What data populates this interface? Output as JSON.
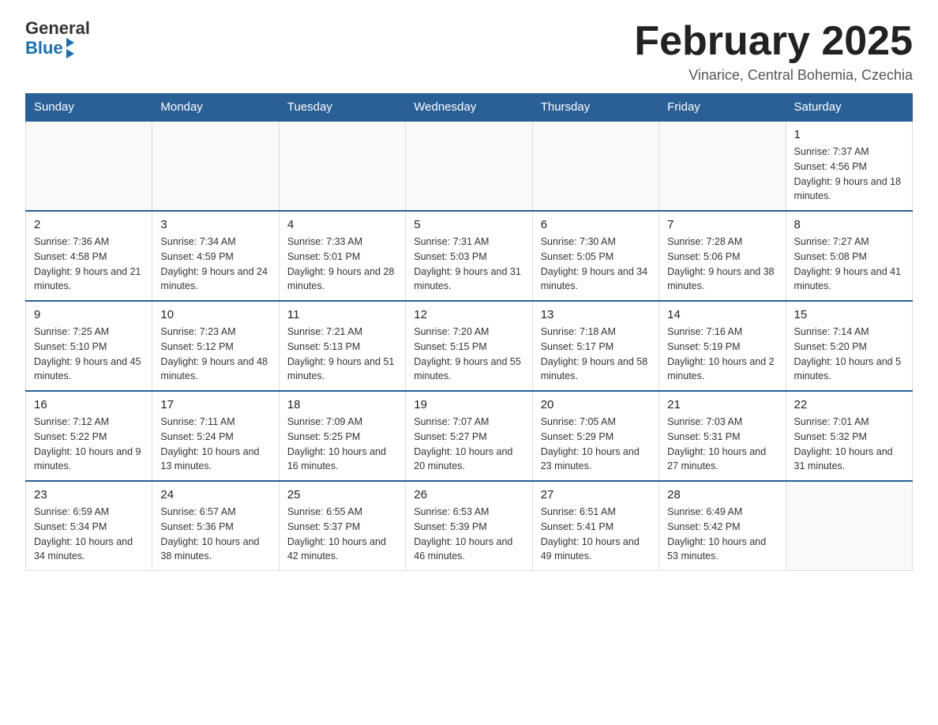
{
  "header": {
    "logo_general": "General",
    "logo_blue": "Blue",
    "month_title": "February 2025",
    "location": "Vinarice, Central Bohemia, Czechia"
  },
  "days_of_week": [
    "Sunday",
    "Monday",
    "Tuesday",
    "Wednesday",
    "Thursday",
    "Friday",
    "Saturday"
  ],
  "weeks": [
    [
      {
        "day": "",
        "info": ""
      },
      {
        "day": "",
        "info": ""
      },
      {
        "day": "",
        "info": ""
      },
      {
        "day": "",
        "info": ""
      },
      {
        "day": "",
        "info": ""
      },
      {
        "day": "",
        "info": ""
      },
      {
        "day": "1",
        "info": "Sunrise: 7:37 AM\nSunset: 4:56 PM\nDaylight: 9 hours and 18 minutes."
      }
    ],
    [
      {
        "day": "2",
        "info": "Sunrise: 7:36 AM\nSunset: 4:58 PM\nDaylight: 9 hours and 21 minutes."
      },
      {
        "day": "3",
        "info": "Sunrise: 7:34 AM\nSunset: 4:59 PM\nDaylight: 9 hours and 24 minutes."
      },
      {
        "day": "4",
        "info": "Sunrise: 7:33 AM\nSunset: 5:01 PM\nDaylight: 9 hours and 28 minutes."
      },
      {
        "day": "5",
        "info": "Sunrise: 7:31 AM\nSunset: 5:03 PM\nDaylight: 9 hours and 31 minutes."
      },
      {
        "day": "6",
        "info": "Sunrise: 7:30 AM\nSunset: 5:05 PM\nDaylight: 9 hours and 34 minutes."
      },
      {
        "day": "7",
        "info": "Sunrise: 7:28 AM\nSunset: 5:06 PM\nDaylight: 9 hours and 38 minutes."
      },
      {
        "day": "8",
        "info": "Sunrise: 7:27 AM\nSunset: 5:08 PM\nDaylight: 9 hours and 41 minutes."
      }
    ],
    [
      {
        "day": "9",
        "info": "Sunrise: 7:25 AM\nSunset: 5:10 PM\nDaylight: 9 hours and 45 minutes."
      },
      {
        "day": "10",
        "info": "Sunrise: 7:23 AM\nSunset: 5:12 PM\nDaylight: 9 hours and 48 minutes."
      },
      {
        "day": "11",
        "info": "Sunrise: 7:21 AM\nSunset: 5:13 PM\nDaylight: 9 hours and 51 minutes."
      },
      {
        "day": "12",
        "info": "Sunrise: 7:20 AM\nSunset: 5:15 PM\nDaylight: 9 hours and 55 minutes."
      },
      {
        "day": "13",
        "info": "Sunrise: 7:18 AM\nSunset: 5:17 PM\nDaylight: 9 hours and 58 minutes."
      },
      {
        "day": "14",
        "info": "Sunrise: 7:16 AM\nSunset: 5:19 PM\nDaylight: 10 hours and 2 minutes."
      },
      {
        "day": "15",
        "info": "Sunrise: 7:14 AM\nSunset: 5:20 PM\nDaylight: 10 hours and 5 minutes."
      }
    ],
    [
      {
        "day": "16",
        "info": "Sunrise: 7:12 AM\nSunset: 5:22 PM\nDaylight: 10 hours and 9 minutes."
      },
      {
        "day": "17",
        "info": "Sunrise: 7:11 AM\nSunset: 5:24 PM\nDaylight: 10 hours and 13 minutes."
      },
      {
        "day": "18",
        "info": "Sunrise: 7:09 AM\nSunset: 5:25 PM\nDaylight: 10 hours and 16 minutes."
      },
      {
        "day": "19",
        "info": "Sunrise: 7:07 AM\nSunset: 5:27 PM\nDaylight: 10 hours and 20 minutes."
      },
      {
        "day": "20",
        "info": "Sunrise: 7:05 AM\nSunset: 5:29 PM\nDaylight: 10 hours and 23 minutes."
      },
      {
        "day": "21",
        "info": "Sunrise: 7:03 AM\nSunset: 5:31 PM\nDaylight: 10 hours and 27 minutes."
      },
      {
        "day": "22",
        "info": "Sunrise: 7:01 AM\nSunset: 5:32 PM\nDaylight: 10 hours and 31 minutes."
      }
    ],
    [
      {
        "day": "23",
        "info": "Sunrise: 6:59 AM\nSunset: 5:34 PM\nDaylight: 10 hours and 34 minutes."
      },
      {
        "day": "24",
        "info": "Sunrise: 6:57 AM\nSunset: 5:36 PM\nDaylight: 10 hours and 38 minutes."
      },
      {
        "day": "25",
        "info": "Sunrise: 6:55 AM\nSunset: 5:37 PM\nDaylight: 10 hours and 42 minutes."
      },
      {
        "day": "26",
        "info": "Sunrise: 6:53 AM\nSunset: 5:39 PM\nDaylight: 10 hours and 46 minutes."
      },
      {
        "day": "27",
        "info": "Sunrise: 6:51 AM\nSunset: 5:41 PM\nDaylight: 10 hours and 49 minutes."
      },
      {
        "day": "28",
        "info": "Sunrise: 6:49 AM\nSunset: 5:42 PM\nDaylight: 10 hours and 53 minutes."
      },
      {
        "day": "",
        "info": ""
      }
    ]
  ]
}
